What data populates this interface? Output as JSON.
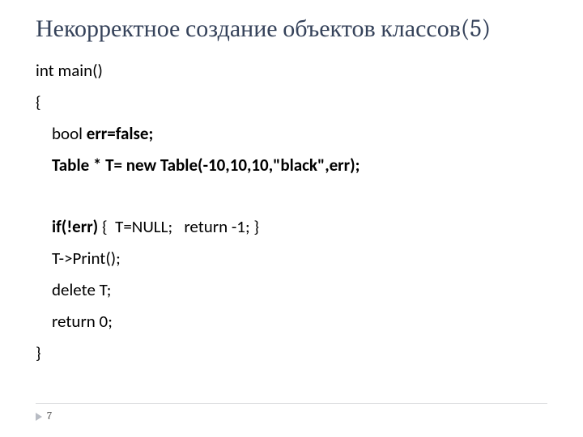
{
  "title": "Некорректное создание объектов классов(5)",
  "code": {
    "l1": "int main()",
    "l2": "{",
    "l3_pre": "bool ",
    "l3_b": "err=false;",
    "l4_b": "Table * T= new Table(-10,10,10,\"black\",err);",
    "l5_b": "if(!err) ",
    "l5_rest": "{  T=NULL;   return -1; }",
    "l6": "T->Print();",
    "l7": "delete T;",
    "l8": "return 0;",
    "l9": "}"
  },
  "page_number": "7"
}
